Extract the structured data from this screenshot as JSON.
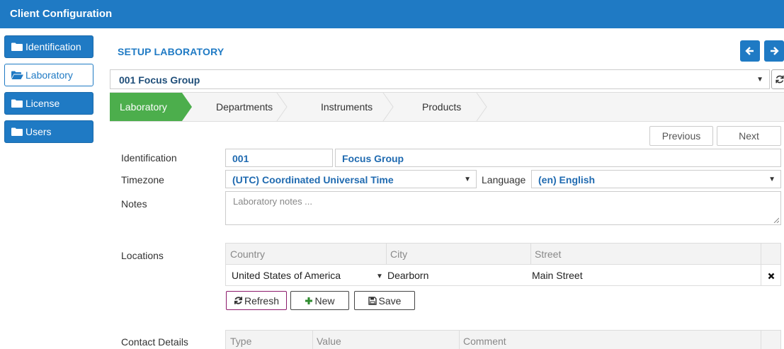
{
  "app": {
    "title": "Client Configuration"
  },
  "sidebar": {
    "items": [
      {
        "label": "Identification",
        "active": false
      },
      {
        "label": "Laboratory",
        "active": true
      },
      {
        "label": "License",
        "active": false
      },
      {
        "label": "Users",
        "active": false
      }
    ]
  },
  "header": {
    "title": "SETUP LABORATORY"
  },
  "group_select": {
    "value": "001 Focus Group"
  },
  "wizard": {
    "steps": [
      {
        "label": "Laboratory",
        "active": true
      },
      {
        "label": "Departments",
        "active": false
      },
      {
        "label": "Instruments",
        "active": false
      },
      {
        "label": "Products",
        "active": false
      }
    ]
  },
  "pager": {
    "previous": "Previous",
    "next": "Next"
  },
  "form": {
    "identification_label": "Identification",
    "identification_code": "001",
    "identification_name": "Focus Group",
    "timezone_label": "Timezone",
    "timezone_value": "(UTC) Coordinated Universal Time",
    "language_label": "Language",
    "language_value": "(en) English",
    "notes_label": "Notes",
    "notes_placeholder": "Laboratory notes ..."
  },
  "locations": {
    "label": "Locations",
    "columns": [
      "Country",
      "City",
      "Street"
    ],
    "rows": [
      {
        "country": "United States of America",
        "city": "Dearborn",
        "street": "Main Street"
      }
    ],
    "buttons": {
      "refresh": "Refresh",
      "new": "New",
      "save": "Save"
    }
  },
  "contact_details": {
    "label": "Contact Details",
    "columns": [
      "Type",
      "Value",
      "Comment"
    ]
  },
  "colors": {
    "primary": "#1f7ac4",
    "active_step": "#4cae4c",
    "refresh_border": "#8b1a6b",
    "new_icon": "#2e8b2e"
  }
}
